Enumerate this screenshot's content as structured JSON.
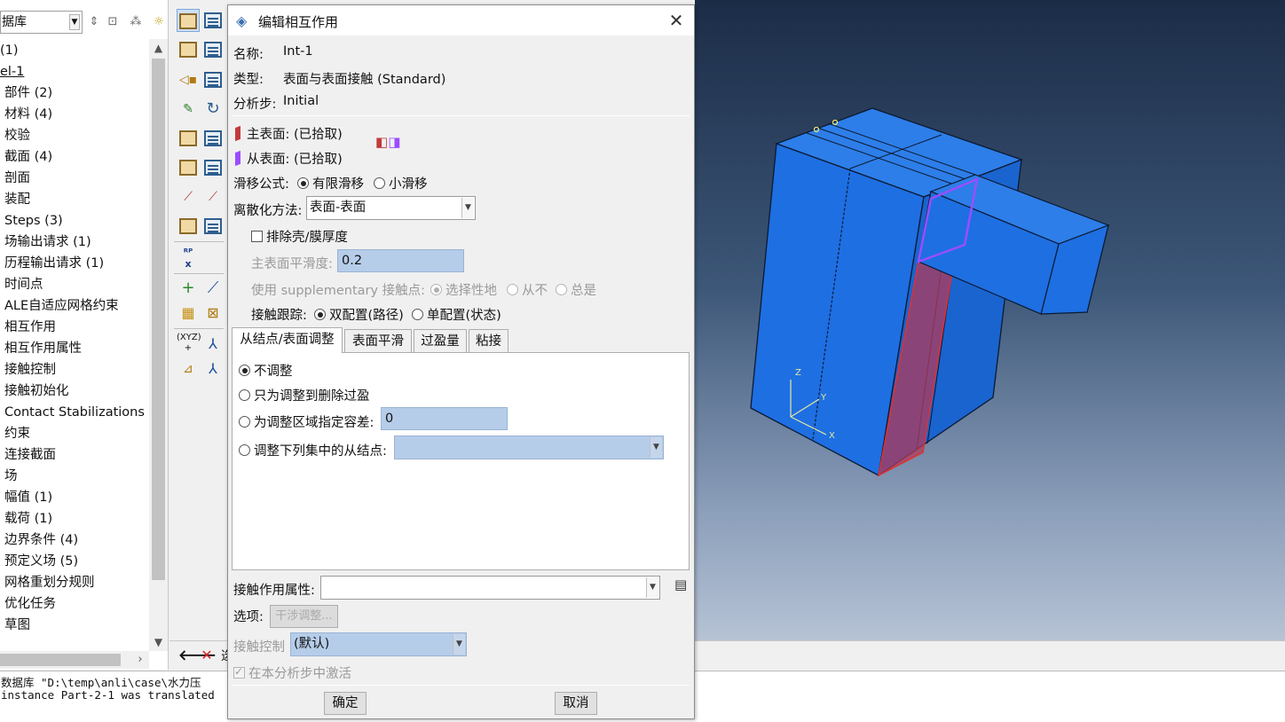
{
  "tree": {
    "db_select": "据库",
    "items": [
      "(1)",
      "el-1",
      "部件 (2)",
      "材料 (4)",
      "校验",
      "截面 (4)",
      "剖面",
      "装配",
      "Steps (3)",
      "场输出请求 (1)",
      "历程输出请求 (1)",
      "时间点",
      "ALE自适应网格约束",
      "相互作用",
      "相互作用属性",
      "接触控制",
      "接触初始化",
      "Contact Stabilizations",
      "约束",
      "连接截面",
      "场",
      "幅值 (1)",
      "载荷 (1)",
      "边界条件 (4)",
      "预定义场 (5)",
      "网格重划分规则",
      "优化任务",
      "草图"
    ]
  },
  "prompt": {
    "text": "选"
  },
  "messages": [
    "数据库 \"D:\\temp\\anli\\case\\水力压",
    "instance Part-2-1 was translated"
  ],
  "viewport": {
    "triad": {
      "x": "X",
      "y": "Y",
      "z": "Z"
    },
    "colors": {
      "part": "#1f6fe0",
      "edge": "#0b1a33",
      "master_surface": "#c23a3a",
      "slave_surface": "#9b4dff"
    }
  },
  "dialog": {
    "title": "编辑相互作用",
    "name_label": "名称:",
    "name_value": "Int-1",
    "type_label": "类型:",
    "type_value": "表面与表面接触 (Standard)",
    "step_label": "分析步:",
    "step_value": "Initial",
    "master_label": "主表面:",
    "master_value": "(已拾取)",
    "slave_label": "从表面:",
    "slave_value": "(已拾取)",
    "sliding_label": "滑移公式:",
    "sliding_options": [
      "有限滑移",
      "小滑移"
    ],
    "discretization_label": "离散化方法:",
    "discretization_value": "表面-表面",
    "exclude_shell_label": "排除壳/膜厚度",
    "smoothing_label": "主表面平滑度:",
    "smoothing_value": "0.2",
    "supplementary_label": "使用 supplementary 接触点:",
    "supplementary_options": [
      "选择性地",
      "从不",
      "总是"
    ],
    "tracking_label": "接触跟踪:",
    "tracking_options": [
      "双配置(路径)",
      "单配置(状态)"
    ],
    "tabs": [
      "从结点/表面调整",
      "表面平滑",
      "过盈量",
      "粘接"
    ],
    "adjust_options": [
      "不调整",
      "只为调整到删除过盈",
      "为调整区域指定容差:",
      "调整下列集中的从结点:"
    ],
    "tolerance_value": "0",
    "property_label": "接触作用属性:",
    "options_label": "选项:",
    "options_button": "干涉调整...",
    "control_label": "接触控制",
    "control_value": "(默认)",
    "activate_label": "在本分析步中激活",
    "ok_button": "确定",
    "cancel_button": "取消"
  }
}
